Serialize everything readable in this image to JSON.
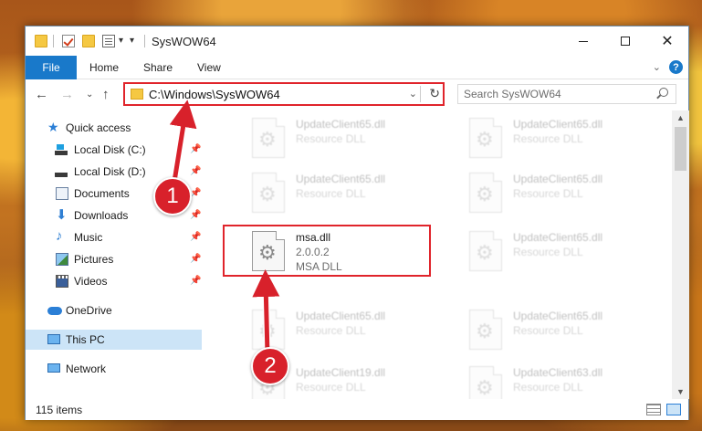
{
  "window": {
    "title": "SysWOW64",
    "qa_dropdown": "▾"
  },
  "ribbon": {
    "file_tab": "File",
    "tabs": [
      "Home",
      "Share",
      "View"
    ],
    "help": "?"
  },
  "nav": {
    "address": "C:\\Windows\\SysWOW64",
    "search_placeholder": "Search SysWOW64"
  },
  "sidebar": {
    "quick_access": "Quick access",
    "items": [
      {
        "label": "Local Disk (C:)",
        "icon": "local-disk-c-icon",
        "pinned": true
      },
      {
        "label": "Local Disk (D:)",
        "icon": "local-disk-d-icon",
        "pinned": true
      },
      {
        "label": "Documents",
        "icon": "documents-icon",
        "pinned": true
      },
      {
        "label": "Downloads",
        "icon": "downloads-icon",
        "pinned": true
      },
      {
        "label": "Music",
        "icon": "music-icon",
        "pinned": true
      },
      {
        "label": "Pictures",
        "icon": "pictures-icon",
        "pinned": true
      },
      {
        "label": "Videos",
        "icon": "videos-icon",
        "pinned": true
      }
    ],
    "onedrive": "OneDrive",
    "this_pc": "This PC",
    "network": "Network"
  },
  "files": {
    "left_column": [
      {
        "name": "UpdateClient65.dll",
        "type": "Resource DLL"
      },
      {
        "name": "UpdateClient65.dll",
        "type": "Resource DLL"
      }
    ],
    "highlighted": {
      "name": "msa.dll",
      "version": "2.0.0.2",
      "type": "MSA DLL"
    },
    "left_column_below": [
      {
        "name": "UpdateClient65.dll",
        "type": "Resource DLL"
      },
      {
        "name": "UpdateClient19.dll",
        "type": "Resource DLL"
      }
    ],
    "right_column": [
      {
        "name": "UpdateClient65.dll",
        "type": "Resource DLL"
      },
      {
        "name": "UpdateClient65.dll",
        "type": "Resource DLL"
      },
      {
        "name": "UpdateClient65.dll",
        "type": "Resource DLL"
      },
      {
        "name": "UpdateClient65.dll",
        "type": "Resource DLL"
      },
      {
        "name": "UpdateClient63.dll",
        "type": "Resource DLL"
      }
    ]
  },
  "status": {
    "item_count": "115 items"
  },
  "annotations": {
    "step1": "1",
    "step2": "2",
    "color": "#d8212b"
  }
}
